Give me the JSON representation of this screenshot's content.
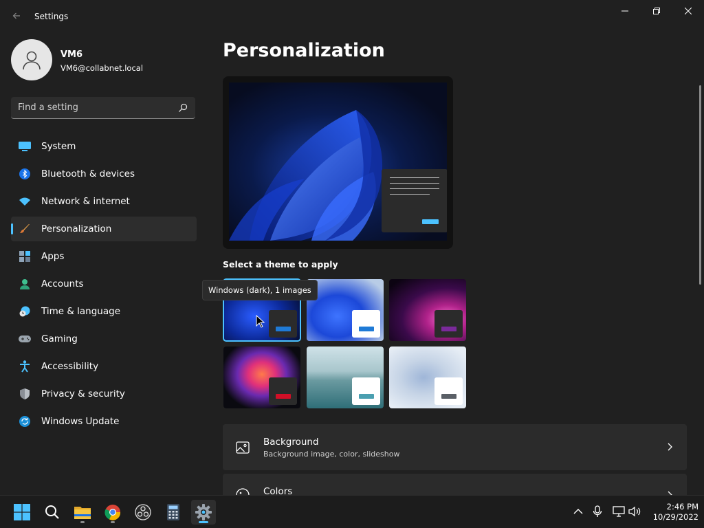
{
  "window": {
    "title": "Settings"
  },
  "profile": {
    "name": "VM6",
    "email": "VM6@collabnet.local"
  },
  "search": {
    "placeholder": "Find a setting",
    "value": ""
  },
  "sidebar": {
    "items": [
      {
        "label": "System",
        "icon": "monitor-icon"
      },
      {
        "label": "Bluetooth & devices",
        "icon": "bluetooth-icon"
      },
      {
        "label": "Network & internet",
        "icon": "wifi-icon"
      },
      {
        "label": "Personalization",
        "icon": "paintbrush-icon",
        "active": true
      },
      {
        "label": "Apps",
        "icon": "apps-icon"
      },
      {
        "label": "Accounts",
        "icon": "person-icon"
      },
      {
        "label": "Time & language",
        "icon": "clock-globe-icon"
      },
      {
        "label": "Gaming",
        "icon": "gamepad-icon"
      },
      {
        "label": "Accessibility",
        "icon": "accessibility-icon"
      },
      {
        "label": "Privacy & security",
        "icon": "shield-icon"
      },
      {
        "label": "Windows Update",
        "icon": "update-icon"
      }
    ]
  },
  "main": {
    "title": "Personalization",
    "themes_label": "Select a theme to apply",
    "tooltip": "Windows (dark), 1 images",
    "themes": [
      {
        "name": "windows-dark",
        "selected": true,
        "accent": "#1f7ad6"
      },
      {
        "name": "windows-light",
        "selected": false,
        "accent": "#1f7ad6"
      },
      {
        "name": "glow",
        "selected": false,
        "accent": "#7a2a9a"
      },
      {
        "name": "captured-motion",
        "selected": false,
        "accent": "#d10f27"
      },
      {
        "name": "sunrise",
        "selected": false,
        "accent": "#4a9fb0"
      },
      {
        "name": "flow",
        "selected": false,
        "accent": "#5a5f66"
      }
    ],
    "cards": [
      {
        "title": "Background",
        "subtitle": "Background image, color, slideshow",
        "icon": "image-icon"
      },
      {
        "title": "Colors",
        "subtitle": "",
        "icon": "palette-icon"
      }
    ]
  },
  "taskbar": {
    "apps": [
      "start",
      "search",
      "file-explorer",
      "chrome",
      "obs",
      "calculator",
      "settings"
    ],
    "active_app": "settings",
    "time": "2:46 PM",
    "date": "10/29/2022"
  },
  "colors": {
    "accent": "#4cc2ff",
    "background": "#202020",
    "card": "#2b2b2b"
  }
}
